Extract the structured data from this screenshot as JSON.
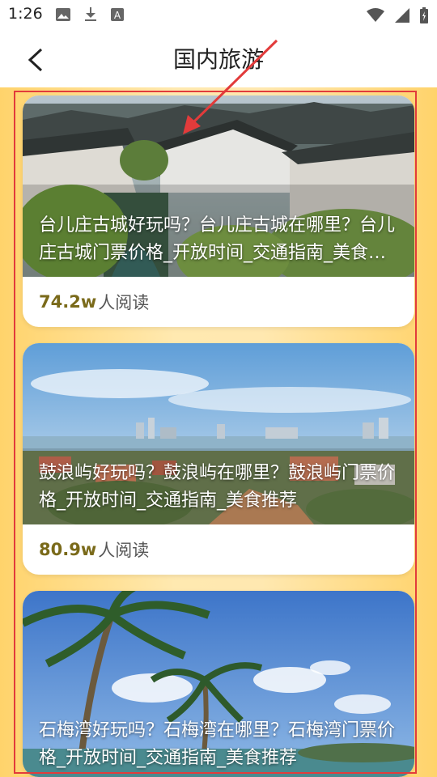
{
  "status_bar": {
    "time": "1:26"
  },
  "header": {
    "title": "国内旅游",
    "back_icon": "chevron-left-icon"
  },
  "articles": [
    {
      "title": "台儿庄古城好玩吗？台儿庄古城在哪里？台儿庄古城门票价格_开放时间_交通指南_美食推荐",
      "read_count": "74.2w",
      "read_label": "人阅读"
    },
    {
      "title": "鼓浪屿好玩吗？鼓浪屿在哪里？鼓浪屿门票价格_开放时间_交通指南_美食推荐",
      "read_count": "80.9w",
      "read_label": "人阅读"
    },
    {
      "title": "石梅湾好玩吗？石梅湾在哪里？石梅湾门票价格_开放时间_交通指南_美食推荐",
      "read_count": "",
      "read_label": ""
    }
  ],
  "colors": {
    "accent_read": "#7a6a1a",
    "highlight": "#e23b3b",
    "background": "#ffe8b0"
  }
}
